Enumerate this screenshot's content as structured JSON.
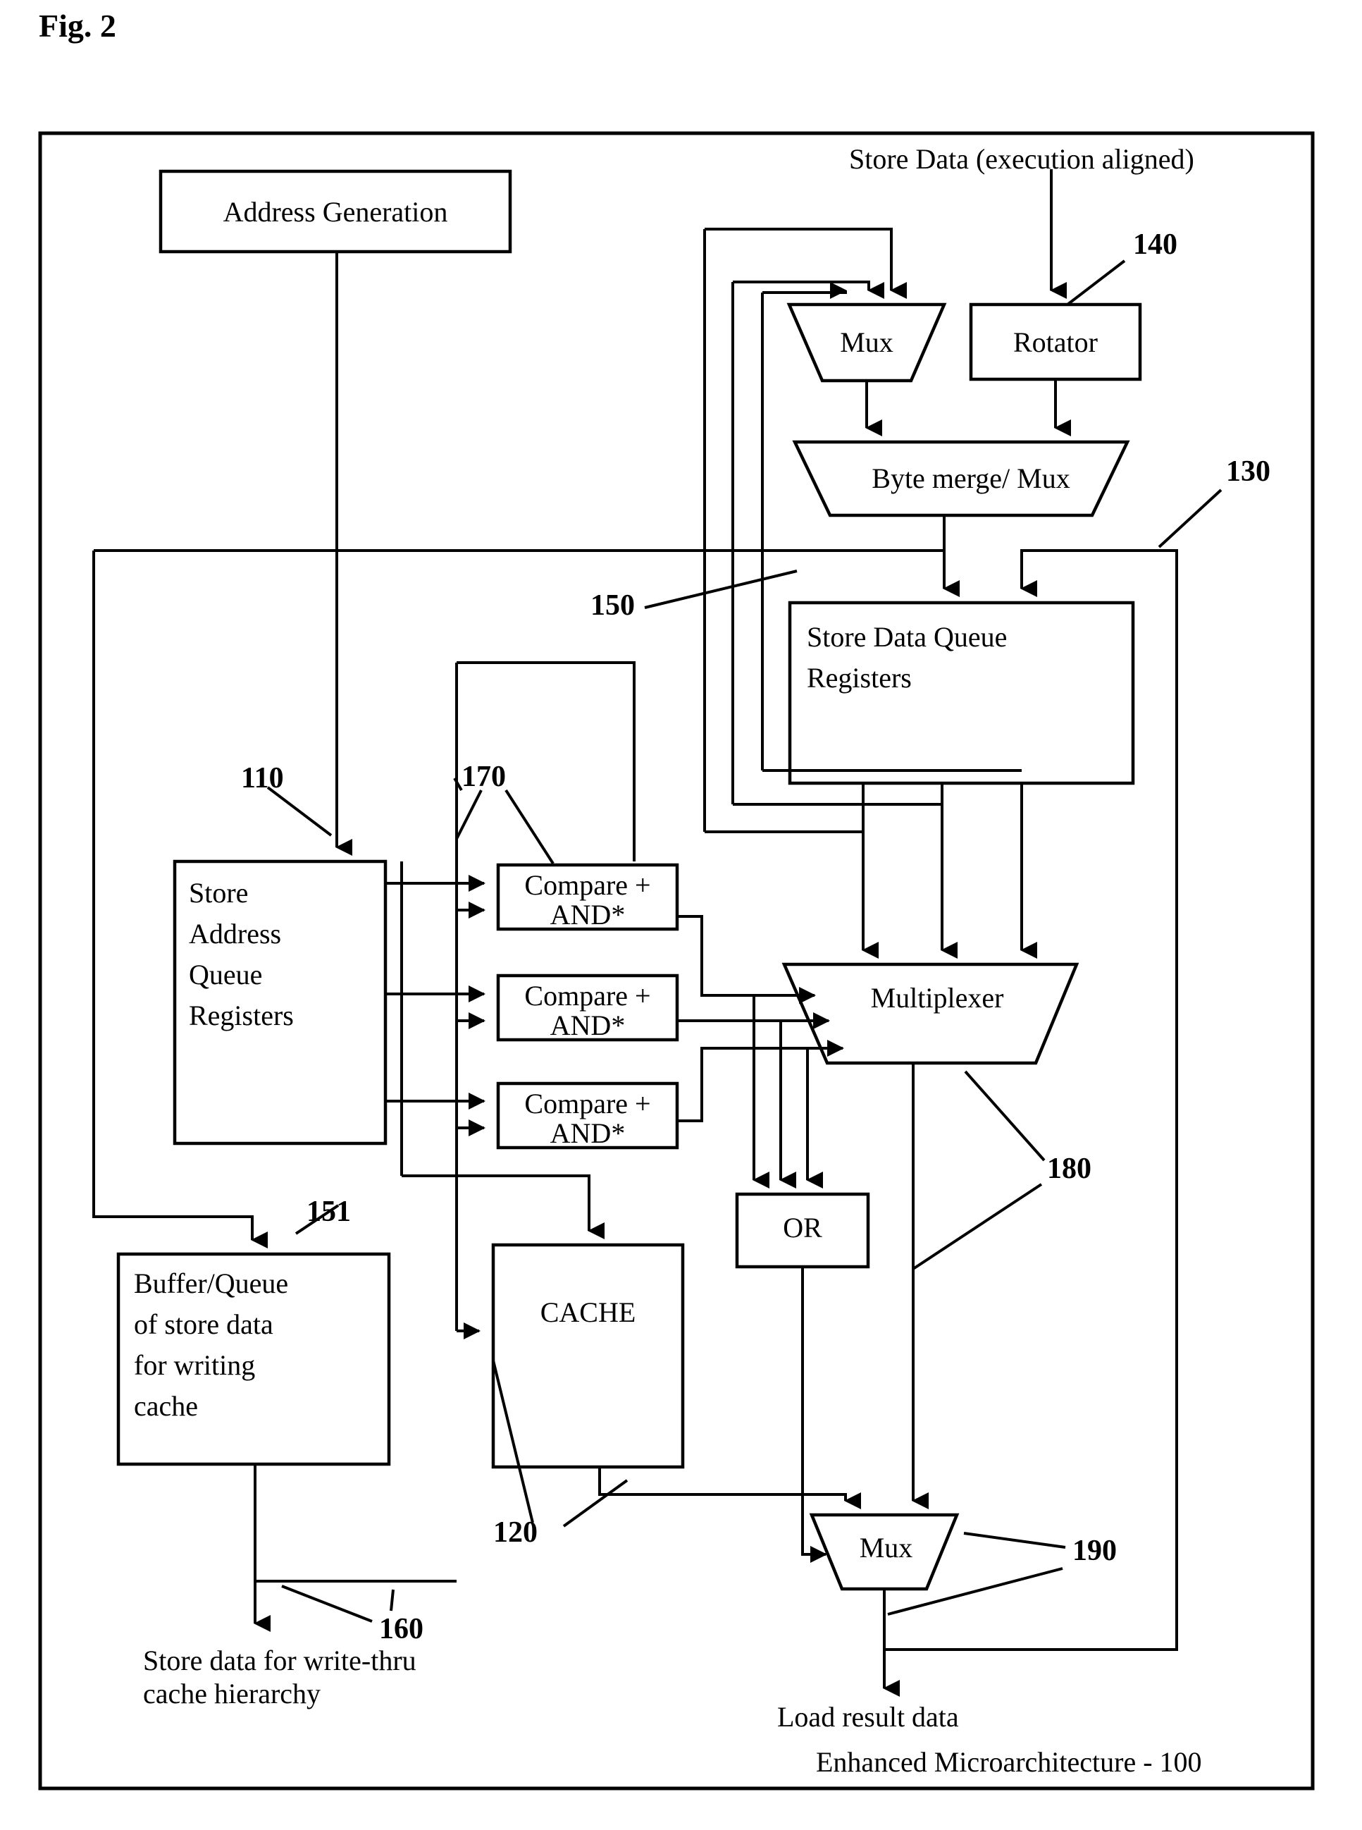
{
  "figure": {
    "title": "Fig. 2",
    "caption": "Enhanced Microarchitecture - 100"
  },
  "labels": {
    "store_data_input": "Store Data  (execution aligned)",
    "store_data_output": "Store data for write-thru cache hierarchy",
    "load_result_output": "Load result data"
  },
  "blocks": {
    "address_generation": {
      "label": "Address Generation"
    },
    "mux_top": {
      "label": "Mux"
    },
    "rotator": {
      "label": "Rotator",
      "ref": "140"
    },
    "byte_merge_mux": {
      "label": "Byte merge/ Mux"
    },
    "store_data_queue": {
      "label_line1": "Store Data Queue",
      "label_line2": "Registers",
      "ref": "130",
      "ref2": "150"
    },
    "store_address_queue": {
      "label_line1": "Store",
      "label_line2": "Address",
      "label_line3": "Queue",
      "label_line4": "Registers",
      "ref": "110"
    },
    "compare_and_1": {
      "label_line1": "Compare +",
      "label_line2": "AND*",
      "ref": "170"
    },
    "compare_and_2": {
      "label_line1": "Compare +",
      "label_line2": "AND*"
    },
    "compare_and_3": {
      "label_line1": "Compare +",
      "label_line2": "AND*"
    },
    "multiplexer": {
      "label": "Multiplexer",
      "ref": "180"
    },
    "or_gate": {
      "label": "OR"
    },
    "cache": {
      "label": "CACHE",
      "ref": "120"
    },
    "buffer_queue": {
      "label_line1": "Buffer/Queue",
      "label_line2": "of store data",
      "label_line3": "for writing",
      "label_line4": "cache",
      "ref": "151"
    },
    "mux_bottom": {
      "label": "Mux",
      "ref": "190"
    },
    "store_data_out_ref": "160"
  },
  "reference_numerals": [
    "110",
    "120",
    "130",
    "140",
    "150",
    "151",
    "160",
    "170",
    "180",
    "190",
    "100"
  ],
  "colors": {
    "line": "#000000",
    "fill": "#ffffff",
    "background": "#ffffff"
  }
}
